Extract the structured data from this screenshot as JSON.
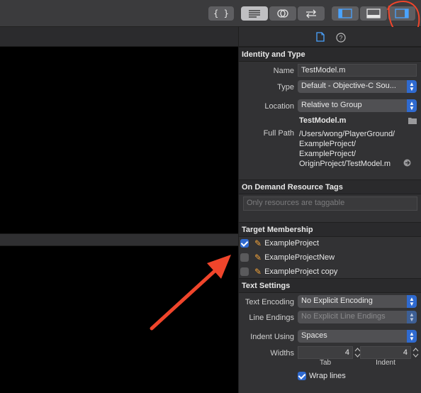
{
  "toolbar": {
    "buttons": [
      "braces-icon",
      "lines-icon",
      "venn-icon",
      "swap-arrows-icon",
      "navigator-toggle-icon",
      "debug-area-toggle-icon",
      "inspector-toggle-icon"
    ]
  },
  "inspector_tabs": [
    "file-inspector-icon",
    "quick-help-icon"
  ],
  "identity": {
    "header": "Identity and Type",
    "name_label": "Name",
    "name_value": "TestModel.m",
    "type_label": "Type",
    "type_value": "Default - Objective-C Sou...",
    "location_label": "Location",
    "location_value": "Relative to Group",
    "file_name": "TestModel.m",
    "full_path_label": "Full Path",
    "full_path_lines": [
      "/Users/wong/PlayerGround/",
      "ExampleProject/",
      "ExampleProject/",
      "OriginProject/TestModel.m"
    ]
  },
  "on_demand": {
    "header": "On Demand Resource Tags",
    "placeholder": "Only resources are taggable"
  },
  "target_membership": {
    "header": "Target Membership",
    "targets": [
      {
        "name": "ExampleProject",
        "checked": true
      },
      {
        "name": "ExampleProjectNew",
        "checked": false
      },
      {
        "name": "ExampleProject copy",
        "checked": false
      }
    ]
  },
  "text_settings": {
    "header": "Text Settings",
    "encoding_label": "Text Encoding",
    "encoding_value": "No Explicit Encoding",
    "line_endings_label": "Line Endings",
    "line_endings_value": "No Explicit Line Endings",
    "indent_using_label": "Indent Using",
    "indent_using_value": "Spaces",
    "widths_label": "Widths",
    "tab_value": "4",
    "tab_caption": "Tab",
    "indent_value": "4",
    "indent_caption": "Indent",
    "wrap_lines_label": "Wrap lines",
    "wrap_lines_checked": true
  },
  "colors": {
    "accent": "#2f6ad0",
    "annotation": "#f0452b"
  }
}
